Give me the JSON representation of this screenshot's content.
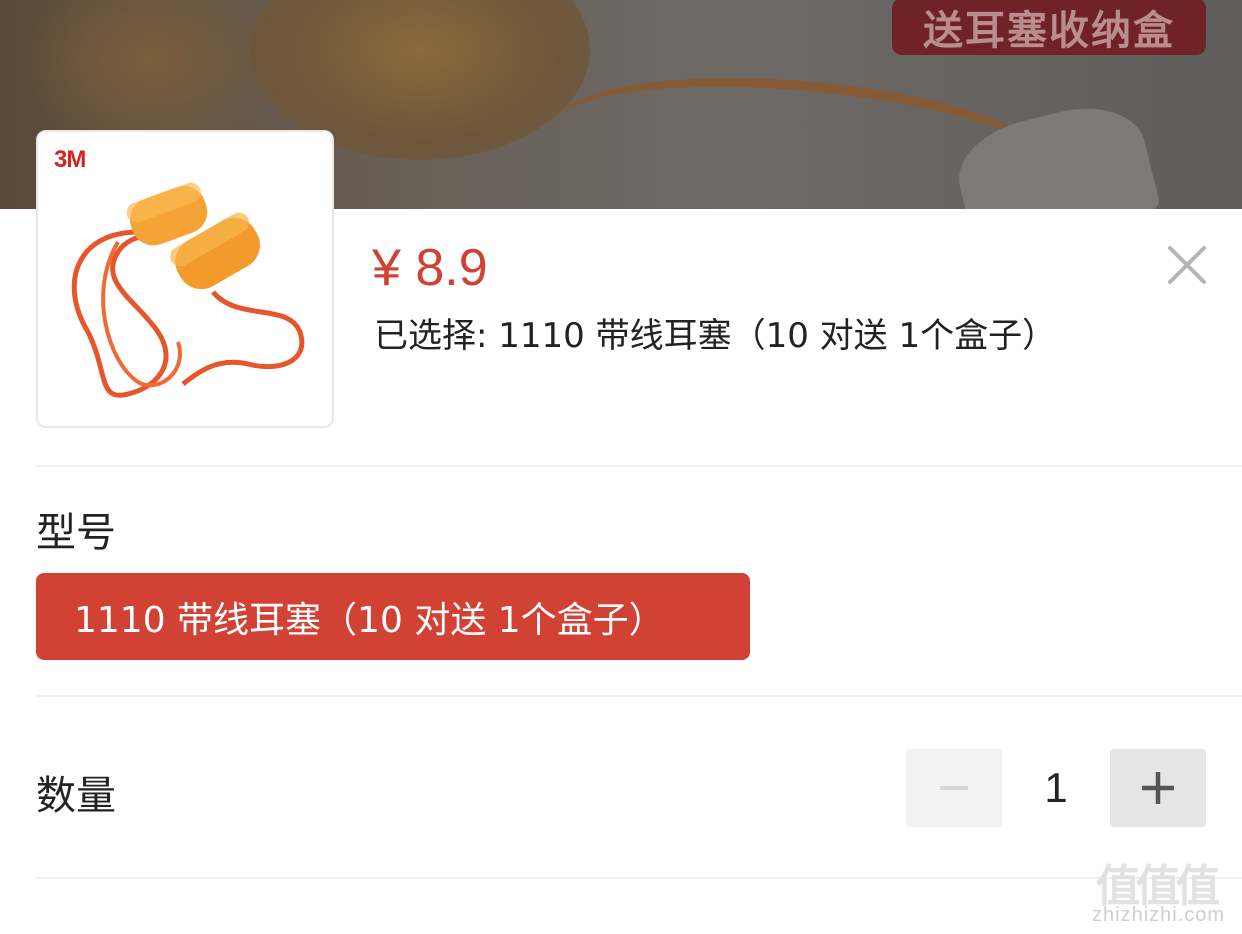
{
  "banner": {
    "tag_text": "送耳塞收纳盒"
  },
  "product": {
    "brand": "3M",
    "price": "¥ 8.9",
    "selected_text": "已选择: 1110 带线耳塞（10 对送 1个盒子）"
  },
  "model_section": {
    "label": "型号",
    "options": [
      {
        "label": "1110 带线耳塞（10 对送 1个盒子）",
        "selected": true
      }
    ]
  },
  "quantity_section": {
    "label": "数量",
    "value": "1",
    "decrement_symbol": "−",
    "increment_symbol": "+"
  },
  "watermark": {
    "logo_text": "值值值",
    "url_text": "zhizhizhi.com"
  },
  "colors": {
    "accent": "#d14235",
    "stepper_disabled": "#f2f2f2",
    "stepper_enabled": "#e5e5e5"
  },
  "icons": {
    "close": "close-icon",
    "minus": "minus-icon",
    "plus": "plus-icon"
  }
}
